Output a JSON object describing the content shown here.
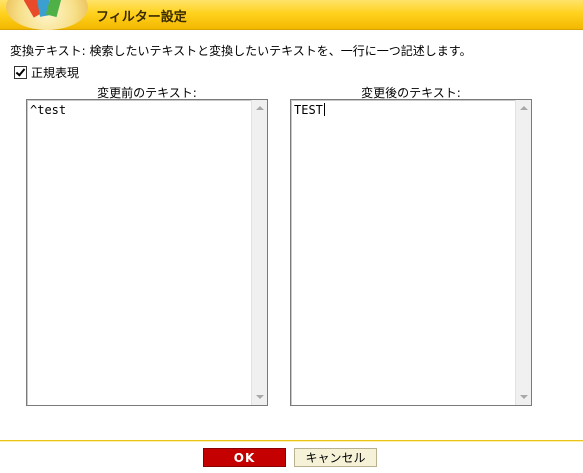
{
  "window": {
    "title": "フィルター設定"
  },
  "description": "変換テキスト: 検索したいテキストと変換したいテキストを、一行に一つ記述します。",
  "regex": {
    "label": "正規表現",
    "checked": true
  },
  "before": {
    "label": "変更前のテキスト:",
    "value": "^test"
  },
  "after": {
    "label": "変更後のテキスト:",
    "value": "TEST"
  },
  "buttons": {
    "ok": "OK",
    "cancel": "キャンセル"
  },
  "colors": {
    "titlebar": "#ffd21f",
    "ok_button": "#c40000",
    "cancel_button": "#f6f2d8"
  },
  "icons": {
    "logo": "app-logo-icon",
    "checkbox": "checkbox-checked-icon"
  }
}
